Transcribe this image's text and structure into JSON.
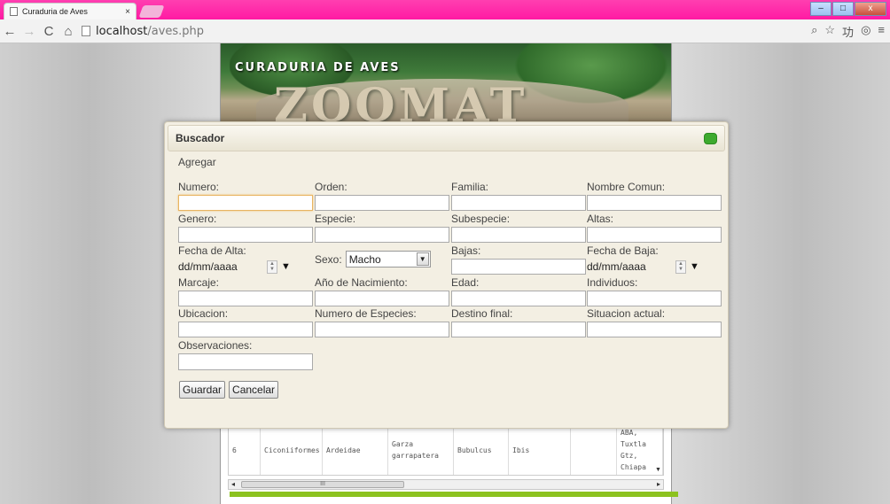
{
  "browser": {
    "tab_title": "Curaduria de Aves",
    "tab_close": "×",
    "url_host": "localhost",
    "url_path": "/aves.php",
    "window_controls": [
      "–",
      "□",
      "x"
    ]
  },
  "banner": {
    "title": "CURADURIA DE AVES",
    "letters": "ZOOMAT"
  },
  "dialog": {
    "title": "Buscador",
    "agregar": "Agregar",
    "fields": {
      "numero": "Numero:",
      "orden": "Orden:",
      "familia": "Familia:",
      "nombre_comun": "Nombre Comun:",
      "genero": "Genero:",
      "especie": "Especie:",
      "subespecie": "Subespecie:",
      "altas": "Altas:",
      "fecha_alta": "Fecha de Alta:",
      "sexo": "Sexo:",
      "bajas": "Bajas:",
      "fecha_baja": "Fecha de Baja:",
      "marcaje": "Marcaje:",
      "anio_nacimiento": "Año de Nacimiento:",
      "edad": "Edad:",
      "individuos": "Individuos:",
      "ubicacion": "Ubicacion:",
      "numero_especies": "Numero de Especies:",
      "destino_final": "Destino final:",
      "situacion_actual": "Situacion actual:",
      "observaciones": "Observaciones:"
    },
    "date_placeholder": "dd/mm/aaaa",
    "sexo_value": "Macho",
    "save_label": "Guardar",
    "cancel_label": "Cancelar"
  },
  "table_row": [
    "6",
    "Ciconiiformes",
    "Ardeidae",
    "Garza garrapatera",
    "Bubulcus",
    "Ibis",
    "",
    "ABA, Tuxtla Gtz, Chiapa"
  ],
  "scroll_thumb": "III",
  "colors": {
    "accent_green": "#8cc21f",
    "titlebar_pink": "#ff1aa3",
    "dialog_bg": "#f3efe3"
  }
}
